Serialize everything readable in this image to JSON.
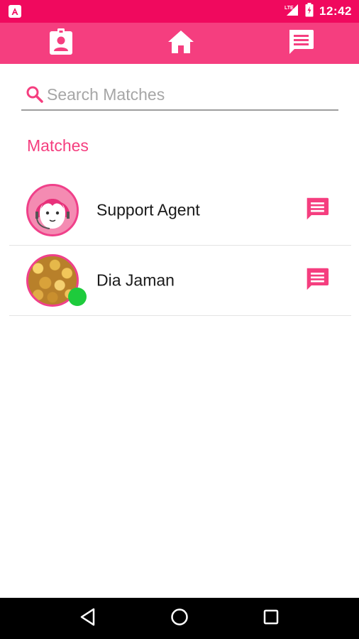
{
  "status_bar": {
    "app_badge_letter": "A",
    "network_label": "LTE",
    "time": "12:42"
  },
  "toolbar": {
    "icons": [
      "profile-badge-icon",
      "home-icon",
      "chat-icon"
    ],
    "active_color": "#f53e7f"
  },
  "search": {
    "placeholder": "Search Matches",
    "value": ""
  },
  "section": {
    "title": "Matches"
  },
  "matches": [
    {
      "name": "Support Agent",
      "avatar": "support-agent-avatar",
      "online": false
    },
    {
      "name": "Dia Jaman",
      "avatar": "photo-avatar",
      "online": true
    }
  ],
  "colors": {
    "status_bar": "#f0095e",
    "accent": "#f53e7f",
    "online": "#1ecb3c"
  },
  "nav": {
    "icons": [
      "back-icon",
      "home-circle-icon",
      "recents-icon"
    ]
  }
}
